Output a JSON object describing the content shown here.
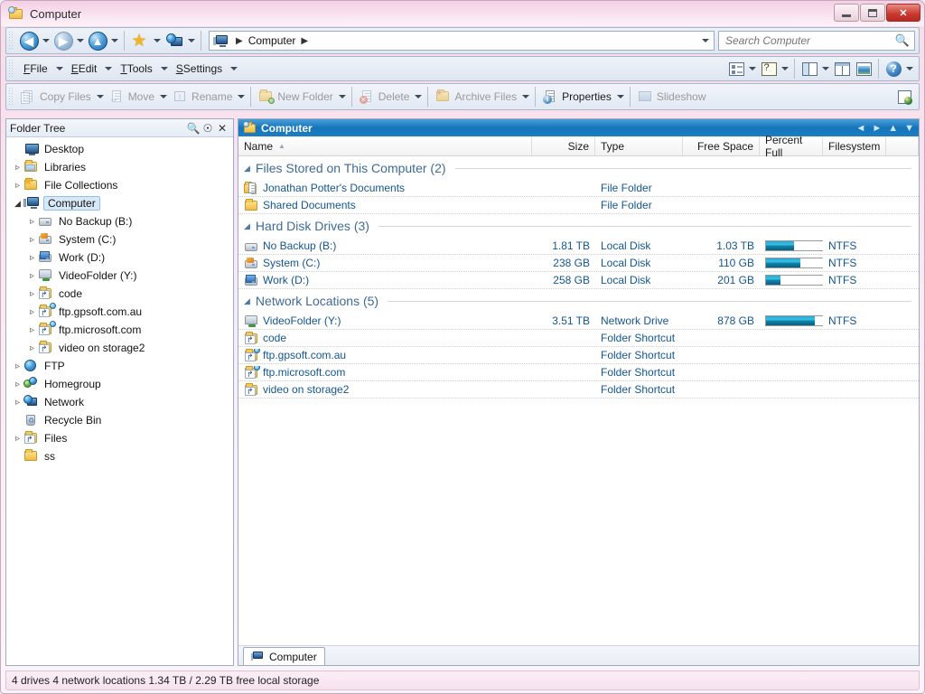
{
  "window": {
    "title": "Computer",
    "icon": "computer-folder-icon",
    "controls": {
      "minimize": "Minimize",
      "maximize": "Maximize",
      "close": "Close"
    }
  },
  "navbar": {
    "back": "Back",
    "forward": "Forward",
    "up": "Up",
    "favorites": "Favorites",
    "network": "My Computer",
    "address": {
      "root_icon": "computer-icon",
      "crumbs": [
        "Computer"
      ]
    },
    "search": {
      "placeholder": "Search Computer",
      "value": "",
      "icon": "search-icon"
    }
  },
  "menubar": {
    "items": [
      {
        "label": "File",
        "accel": "F"
      },
      {
        "label": "Edit",
        "accel": "E"
      },
      {
        "label": "Tools",
        "accel": "T"
      },
      {
        "label": "Settings",
        "accel": "S"
      }
    ],
    "right_buttons": [
      {
        "name": "view-mode-button",
        "icon": "list-view-icon"
      },
      {
        "name": "edit-description-button",
        "icon": "question-pencil-icon"
      },
      {
        "name": "layout-button",
        "icon": "single-pane-icon"
      },
      {
        "name": "dual-pane-button",
        "icon": "dual-pane-icon"
      },
      {
        "name": "preview-pane-button",
        "icon": "image-preview-icon"
      },
      {
        "name": "help-button",
        "icon": "help-icon"
      }
    ]
  },
  "toolbar": {
    "buttons": [
      {
        "label": "Copy Files",
        "accel": "C",
        "icon": "copy-icon",
        "enabled": false,
        "dropdown": true
      },
      {
        "label": "Move",
        "accel": "M",
        "icon": "move-icon",
        "enabled": false,
        "dropdown": true
      },
      {
        "label": "Rename",
        "accel": "R",
        "icon": "rename-icon",
        "enabled": false,
        "dropdown": true
      },
      {
        "label": "New Folder",
        "accel": "w",
        "icon": "new-folder-icon",
        "enabled": false,
        "dropdown": true
      },
      {
        "label": "Delete",
        "accel": "D",
        "icon": "delete-icon",
        "enabled": false,
        "dropdown": true
      },
      {
        "label": "Archive Files",
        "accel": "A",
        "icon": "archive-icon",
        "enabled": false,
        "dropdown": true
      },
      {
        "label": "Properties",
        "accel": "o",
        "icon": "properties-icon",
        "enabled": true,
        "dropdown": true
      },
      {
        "label": "Slideshow",
        "accel": "",
        "icon": "slideshow-icon",
        "enabled": false,
        "dropdown": false
      }
    ],
    "far_right": {
      "name": "customize-toolbar-button",
      "icon": "page-globe-icon"
    }
  },
  "tree": {
    "header": {
      "title": "Folder Tree",
      "search_icon": "search-icon",
      "pin_icon": "unpin-icon",
      "close_icon": "close-icon"
    },
    "items": [
      {
        "label": "Desktop",
        "icon": "monitor-icon",
        "indent": 0,
        "expander": "none",
        "selected": false
      },
      {
        "label": "Libraries",
        "icon": "folder-open-icon",
        "indent": 0,
        "expander": "closed",
        "selected": false
      },
      {
        "label": "File Collections",
        "icon": "folder-star-icon",
        "indent": 0,
        "expander": "closed",
        "selected": false
      },
      {
        "label": "Computer",
        "icon": "computer-icon",
        "indent": 0,
        "expander": "open",
        "selected": true
      },
      {
        "label": "No Backup (B:)",
        "icon": "drive-icon",
        "indent": 1,
        "expander": "closed",
        "selected": false
      },
      {
        "label": "System (C:)",
        "icon": "drive-system-icon",
        "indent": 1,
        "expander": "closed",
        "selected": false
      },
      {
        "label": "Work (D:)",
        "icon": "drive-work-icon",
        "indent": 1,
        "expander": "closed",
        "selected": false
      },
      {
        "label": "VideoFolder (Y:)",
        "icon": "network-drive-icon",
        "indent": 1,
        "expander": "closed",
        "selected": false
      },
      {
        "label": "code",
        "icon": "folder-shortcut-icon",
        "indent": 1,
        "expander": "closed",
        "selected": false
      },
      {
        "label": "ftp.gpsoft.com.au",
        "icon": "ftp-folder-icon",
        "indent": 1,
        "expander": "closed",
        "selected": false
      },
      {
        "label": "ftp.microsoft.com",
        "icon": "ftp-folder-icon",
        "indent": 1,
        "expander": "closed",
        "selected": false
      },
      {
        "label": "video on storage2",
        "icon": "folder-shortcut-icon",
        "indent": 1,
        "expander": "closed",
        "selected": false
      },
      {
        "label": "FTP",
        "icon": "globe-icon",
        "indent": 0,
        "expander": "closed",
        "selected": false
      },
      {
        "label": "Homegroup",
        "icon": "homegroup-icon",
        "indent": 0,
        "expander": "closed",
        "selected": false
      },
      {
        "label": "Network",
        "icon": "network-icon",
        "indent": 0,
        "expander": "closed",
        "selected": false
      },
      {
        "label": "Recycle Bin",
        "icon": "recycle-bin-icon",
        "indent": 0,
        "expander": "none",
        "selected": false
      },
      {
        "label": "Files",
        "icon": "folder-shortcut-icon",
        "indent": 0,
        "expander": "closed",
        "selected": false
      },
      {
        "label": "ss",
        "icon": "folder-icon",
        "indent": 0,
        "expander": "none",
        "selected": false
      }
    ]
  },
  "filepane": {
    "header": {
      "title": "Computer",
      "icon": "computer-folder-icon",
      "actions": [
        "back-arrow-icon",
        "forward-arrow-icon",
        "up-arrow-icon",
        "dropdown-arrow-icon"
      ]
    },
    "columns": [
      {
        "label": "Name",
        "align": "left",
        "sorted": true
      },
      {
        "label": "Size",
        "align": "right",
        "sorted": false
      },
      {
        "label": "Type",
        "align": "left",
        "sorted": false
      },
      {
        "label": "Free Space",
        "align": "right",
        "sorted": false
      },
      {
        "label": "Percent Full",
        "align": "left",
        "sorted": false
      },
      {
        "label": "Filesystem",
        "align": "left",
        "sorted": false
      }
    ],
    "groups": [
      {
        "title": "Files Stored on This Computer (2)",
        "rows": [
          {
            "name": "Jonathan Potter's Documents",
            "icon": "documents-icon",
            "size": "",
            "type": "File Folder",
            "free": "",
            "percent": null,
            "fs": ""
          },
          {
            "name": "Shared Documents",
            "icon": "folder-icon",
            "size": "",
            "type": "File Folder",
            "free": "",
            "percent": null,
            "fs": ""
          }
        ]
      },
      {
        "title": "Hard Disk Drives (3)",
        "rows": [
          {
            "name": "No Backup (B:)",
            "icon": "drive-icon",
            "size": "1.81 TB",
            "type": "Local Disk",
            "free": "1.03 TB",
            "percent": 44,
            "fs": "NTFS"
          },
          {
            "name": "System (C:)",
            "icon": "drive-system-icon",
            "size": "238 GB",
            "type": "Local Disk",
            "free": "110 GB",
            "percent": 54,
            "fs": "NTFS"
          },
          {
            "name": "Work (D:)",
            "icon": "drive-work-icon",
            "size": "258 GB",
            "type": "Local Disk",
            "free": "201 GB",
            "percent": 22,
            "fs": "NTFS"
          }
        ]
      },
      {
        "title": "Network Locations (5)",
        "rows": [
          {
            "name": "VideoFolder (Y:)",
            "icon": "network-drive-icon",
            "size": "3.51 TB",
            "type": "Network Drive",
            "free": "878 GB",
            "percent": 76,
            "fs": "NTFS"
          },
          {
            "name": "code",
            "icon": "folder-shortcut-icon",
            "size": "",
            "type": "Folder Shortcut",
            "free": "",
            "percent": null,
            "fs": ""
          },
          {
            "name": "ftp.gpsoft.com.au",
            "icon": "ftp-folder-icon",
            "size": "",
            "type": "Folder Shortcut",
            "free": "",
            "percent": null,
            "fs": ""
          },
          {
            "name": "ftp.microsoft.com",
            "icon": "ftp-folder-icon",
            "size": "",
            "type": "Folder Shortcut",
            "free": "",
            "percent": null,
            "fs": ""
          },
          {
            "name": "video on storage2",
            "icon": "folder-shortcut-icon",
            "size": "",
            "type": "Folder Shortcut",
            "free": "",
            "percent": null,
            "fs": ""
          }
        ]
      }
    ],
    "tabs": [
      {
        "label": "Computer",
        "icon": "computer-icon",
        "active": true
      }
    ]
  },
  "statusbar": {
    "text": "4 drives  4 network locations  1.34 TB / 2.29 TB free local storage"
  },
  "colors": {
    "accent_blue": "#1575bb",
    "link_blue": "#14568f",
    "group_header": "#3e6b95",
    "bar_fill": "#0f7fa8",
    "frame_pink": "#f6dcea",
    "close_red": "#c8372c"
  }
}
